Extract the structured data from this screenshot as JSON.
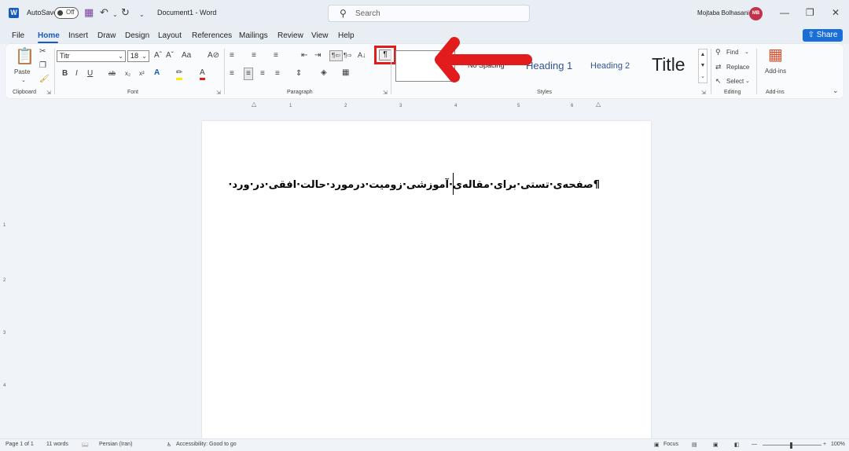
{
  "titlebar": {
    "autosave_label": "AutoSave",
    "toggle_state": "Off",
    "document_title": "Document1  -  Word",
    "search_placeholder": "Search",
    "user_name": "Mojtaba Bolhasani",
    "user_initials": "MB"
  },
  "menu": {
    "tabs": [
      "File",
      "Home",
      "Insert",
      "Draw",
      "Design",
      "Layout",
      "References",
      "Mailings",
      "Review",
      "View",
      "Help"
    ],
    "active_tab": "Home",
    "share_label": "Share"
  },
  "ribbon": {
    "clipboard": {
      "label": "Clipboard",
      "paste_label": "Paste"
    },
    "font": {
      "label": "Font",
      "font_name": "Titr",
      "font_size": "18"
    },
    "paragraph": {
      "label": "Paragraph",
      "show_marks_glyph": "¶"
    },
    "styles": {
      "label": "Styles",
      "items": [
        "No Spacing",
        "Heading 1",
        "Heading 2",
        "Title"
      ]
    },
    "editing": {
      "label": "Editing",
      "find": "Find",
      "replace": "Replace",
      "select": "Select"
    },
    "addins": {
      "label": "Add-ins",
      "button": "Add-ins"
    }
  },
  "ruler": {
    "marks": [
      "1",
      "2",
      "3",
      "4",
      "5",
      "6"
    ]
  },
  "vruler": {
    "marks": [
      "1",
      "2",
      "3",
      "4"
    ]
  },
  "document": {
    "text": "¶صفحه‌ی·تستی·برای·مقاله‌ی·آموزشی·زومیت·درمورد·حالت·افقی·در·ورد·"
  },
  "status": {
    "page": "Page 1 of 1",
    "words": "11 words",
    "language": "Persian (Iran)",
    "accessibility": "Accessibility: Good to go",
    "focus": "Focus",
    "zoom": "100%"
  },
  "colors": {
    "accent": "#185abd",
    "annotation": "#e21c1c",
    "avatar": "#c4314b"
  }
}
